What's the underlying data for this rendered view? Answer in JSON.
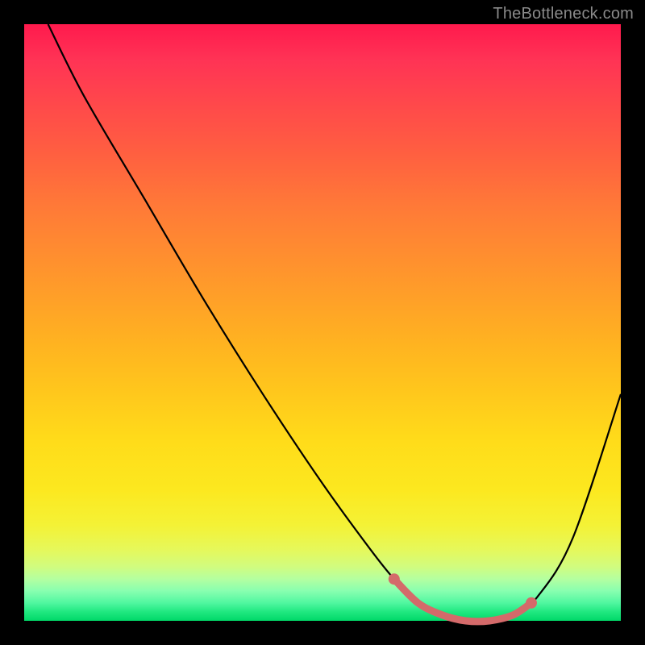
{
  "watermark": "TheBottleneck.com",
  "chart_data": {
    "type": "line",
    "title": "",
    "xlabel": "",
    "ylabel": "",
    "xlim": [
      0,
      100
    ],
    "ylim": [
      0,
      100
    ],
    "background_gradient": {
      "top": "#ff1a4d",
      "bottom": "#00d868"
    },
    "series": [
      {
        "name": "bottleneck-curve",
        "color": "#000000",
        "x": [
          4,
          10,
          20,
          30,
          40,
          50,
          58,
          62,
          66,
          70,
          74,
          78,
          82,
          86,
          92,
          100
        ],
        "y": [
          100,
          88,
          71,
          54,
          38,
          23,
          12,
          7,
          3,
          1,
          0,
          0,
          1,
          4,
          14,
          38
        ]
      },
      {
        "name": "optimal-range-highlight",
        "color": "#d46a6a",
        "x": [
          62,
          66,
          70,
          74,
          78,
          82,
          85
        ],
        "y": [
          7,
          3,
          1,
          0,
          0,
          1,
          3
        ]
      }
    ],
    "annotations": []
  }
}
